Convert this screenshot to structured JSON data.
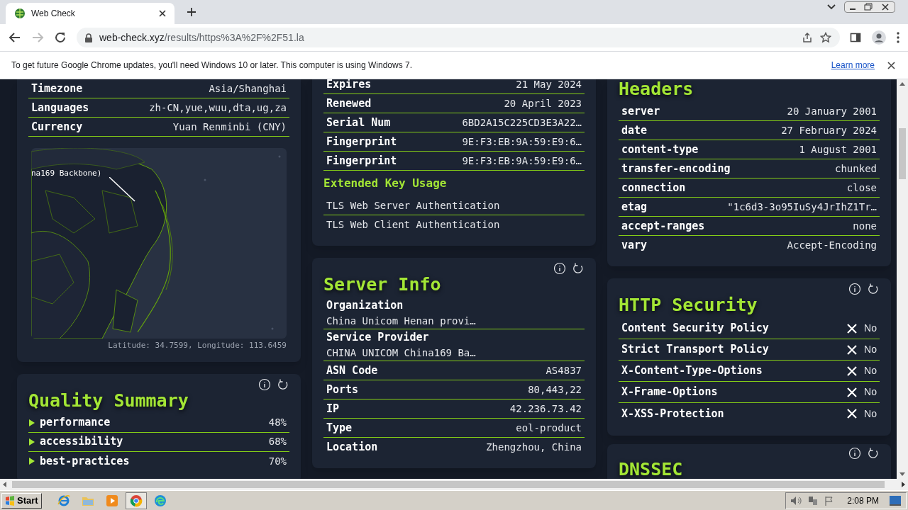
{
  "browser": {
    "tab": {
      "title": "Web Check"
    },
    "address": {
      "domain": "web-check.xyz",
      "path": "/results/https%3A%2F%2F51.la"
    },
    "infobar": {
      "message": "To get future Google Chrome updates, you'll need Windows 10 or later. This computer is using Windows 7.",
      "link": "Learn more"
    }
  },
  "columns": [
    {
      "cards": [
        {
          "actions": false,
          "cut_top": true,
          "blocks": [
            {
              "kind": "rows",
              "rows": [
                {
                  "label": "Timezone",
                  "value": "Asia/Shanghai"
                },
                {
                  "label": "Languages",
                  "value": "zh-CN,yue,wuu,dta,ug,za"
                },
                {
                  "label": "Currency",
                  "value": "Yuan Renminbi (CNY)"
                }
              ]
            },
            {
              "kind": "map",
              "label": "na169 Backbone)",
              "caption": "Latitude: 34.7599, Longitude: 113.6459"
            }
          ]
        },
        {
          "title": "Quality Summary",
          "actions": true,
          "blocks": [
            {
              "kind": "scores",
              "items": [
                {
                  "label": "performance",
                  "value": "48%",
                  "expanded": false
                },
                {
                  "label": "accessibility",
                  "value": "68%",
                  "expanded": false
                },
                {
                  "label": "best-practices",
                  "value": "70%",
                  "expanded": false
                }
              ]
            }
          ]
        }
      ]
    },
    {
      "cards": [
        {
          "actions": false,
          "cut_top": true,
          "blocks": [
            {
              "kind": "rows",
              "rows": [
                {
                  "label": "Expires",
                  "value": "21 May 2024"
                },
                {
                  "label": "Renewed",
                  "value": "20 April 2023"
                },
                {
                  "label": "Serial Num",
                  "value": "6BD2A15C225CD3E3A22…"
                },
                {
                  "label": "Fingerprint",
                  "value": "9E:F3:EB:9A:59:E9:6…"
                },
                {
                  "label": "Fingerprint",
                  "value": "9E:F3:EB:9A:59:E9:6…"
                }
              ]
            },
            {
              "kind": "heading",
              "text": "Extended Key Usage"
            },
            {
              "kind": "list",
              "items": [
                "TLS Web Server Authentication",
                "TLS Web Client Authentication"
              ]
            }
          ]
        },
        {
          "title": "Server Info",
          "actions": true,
          "blocks": [
            {
              "kind": "rows",
              "rows": [
                {
                  "label": "Organization",
                  "value": "China Unicom Henan provi…",
                  "stacked": true
                },
                {
                  "label": "Service Provider",
                  "value": "CHINA UNICOM China169 Ba…",
                  "stacked": true
                },
                {
                  "label": "ASN Code",
                  "value": "AS4837",
                  "stacked": false
                },
                {
                  "label": "Ports",
                  "value": "80,443,22",
                  "stacked": false
                },
                {
                  "label": "IP",
                  "value": "42.236.73.42",
                  "stacked": false
                },
                {
                  "label": "Type",
                  "value": "eol-product",
                  "stacked": false
                },
                {
                  "label": "Location",
                  "value": "Zhengzhou, China",
                  "stacked": false
                }
              ]
            }
          ]
        }
      ]
    },
    {
      "cards": [
        {
          "title": "Headers",
          "actions": false,
          "cut_top": true,
          "blocks": [
            {
              "kind": "rows",
              "rows": [
                {
                  "label": "server",
                  "value": "20 January 2001"
                },
                {
                  "label": "date",
                  "value": "27 February 2024"
                },
                {
                  "label": "content-type",
                  "value": "1 August 2001"
                },
                {
                  "label": "transfer-encoding",
                  "value": "chunked"
                },
                {
                  "label": "connection",
                  "value": "close"
                },
                {
                  "label": "etag",
                  "value": "\"1c6d3-3o95IuSy4JrIhZ1Tr…"
                },
                {
                  "label": "accept-ranges",
                  "value": "none"
                },
                {
                  "label": "vary",
                  "value": "Accept-Encoding"
                }
              ]
            }
          ]
        },
        {
          "title": "HTTP Security",
          "actions": true,
          "blocks": [
            {
              "kind": "checks",
              "items": [
                {
                  "label": "Content Security Policy",
                  "value": "No",
                  "passed": false
                },
                {
                  "label": "Strict Transport Policy",
                  "value": "No",
                  "passed": false
                },
                {
                  "label": "X-Content-Type-Options",
                  "value": "No",
                  "passed": false
                },
                {
                  "label": "X-Frame-Options",
                  "value": "No",
                  "passed": false
                },
                {
                  "label": "X-XSS-Protection",
                  "value": "No",
                  "passed": false
                }
              ]
            }
          ]
        },
        {
          "title": "DNSSEC",
          "actions": true
        }
      ]
    }
  ],
  "taskbar": {
    "start": "Start",
    "clock": "2:08 PM"
  }
}
